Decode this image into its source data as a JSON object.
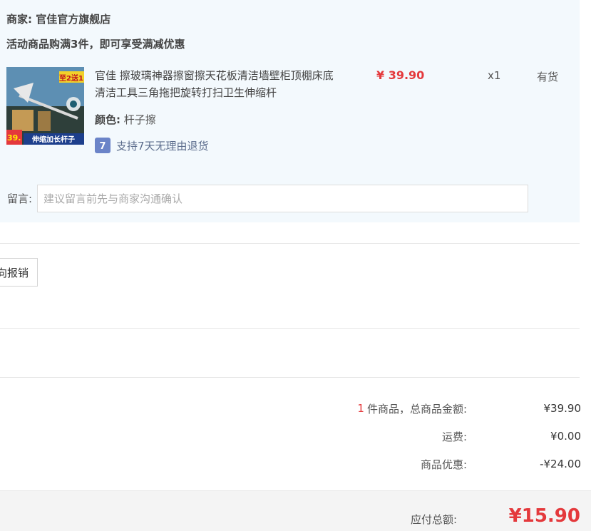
{
  "shop": {
    "label": "商家:",
    "name": "官佳官方旗舰店",
    "promo": "活动商品购满3件，即可享受满减优惠"
  },
  "product": {
    "image_badge": "至2送1",
    "image_price": "39.",
    "image_banner": "伸缩加长杆子",
    "title": "官佳 擦玻璃神器擦窗擦天花板清洁墙壁柜顶棚床底清洁工具三角拖把旋转打扫卫生伸缩杆",
    "price": "¥ 39.90",
    "quantity": "x1",
    "stock": "有货",
    "attr_label": "颜色:",
    "attr_value": "杆子擦",
    "return_icon": "7",
    "return_policy": "支持7天无理由退货"
  },
  "note": {
    "label": "留言:",
    "placeholder": "建议留言前先与商家沟通确认"
  },
  "invoice": {
    "button_label": "向报销"
  },
  "summary": {
    "count": "1",
    "items_label": "件商品，总商品金额:",
    "items_total": "¥39.90",
    "shipping_label": "运费:",
    "shipping_value": "¥0.00",
    "discount_label": "商品优惠:",
    "discount_value": "-¥24.00",
    "payable_label": "应付总额:",
    "payable_value": "¥15.90"
  },
  "colors": {
    "accent_red": "#e4393c",
    "shop_bg": "#f3f9fd",
    "return_badge": "#6b84c8"
  }
}
